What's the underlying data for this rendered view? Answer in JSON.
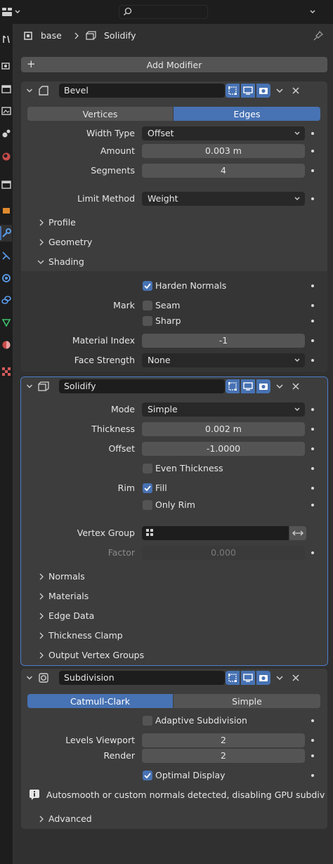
{
  "header": {
    "editor_type_icon": "properties-editor-icon",
    "search_placeholder": ""
  },
  "breadcrumb": {
    "object": "base",
    "modifier": "Solidify"
  },
  "add_modifier_label": "Add Modifier",
  "bevel": {
    "name": "Bevel",
    "mode_tabs": [
      "Vertices",
      "Edges"
    ],
    "active_tab": "Edges",
    "width_type_label": "Width Type",
    "width_type": "Offset",
    "amount_label": "Amount",
    "amount": "0.003 m",
    "segments_label": "Segments",
    "segments": "4",
    "limit_method_label": "Limit Method",
    "limit_method": "Weight",
    "subpanels": [
      "Profile",
      "Geometry",
      "Shading"
    ],
    "harden_normals": "Harden Normals",
    "mark_label": "Mark",
    "seam": "Seam",
    "sharp": "Sharp",
    "material_index_label": "Material Index",
    "material_index": "-1",
    "face_strength_label": "Face Strength",
    "face_strength": "None"
  },
  "solidify": {
    "name": "Solidify",
    "mode_label": "Mode",
    "mode": "Simple",
    "thickness_label": "Thickness",
    "thickness": "0.002 m",
    "offset_label": "Offset",
    "offset": "-1.0000",
    "even_thickness": "Even Thickness",
    "rim_label": "Rim",
    "fill": "Fill",
    "only_rim": "Only Rim",
    "vertex_group_label": "Vertex Group",
    "factor_label": "Factor",
    "factor": "0.000",
    "subpanels": [
      "Normals",
      "Materials",
      "Edge Data",
      "Thickness Clamp",
      "Output Vertex Groups"
    ]
  },
  "subdivision": {
    "name": "Subdivision",
    "mode_tabs": [
      "Catmull-Clark",
      "Simple"
    ],
    "active_tab": "Catmull-Clark",
    "adaptive": "Adaptive Subdivision",
    "levels_viewport_label": "Levels Viewport",
    "levels_viewport": "2",
    "render_label": "Render",
    "render": "2",
    "optimal_display": "Optimal Display",
    "info": "Autosmooth or custom normals detected, disabling GPU subdivisi...",
    "advanced": "Advanced"
  },
  "colors": {
    "accent": "#4772b3",
    "panel": "#303030",
    "modifier_bg": "#3d3d3d",
    "field": "#545454",
    "dropdown": "#282828"
  }
}
